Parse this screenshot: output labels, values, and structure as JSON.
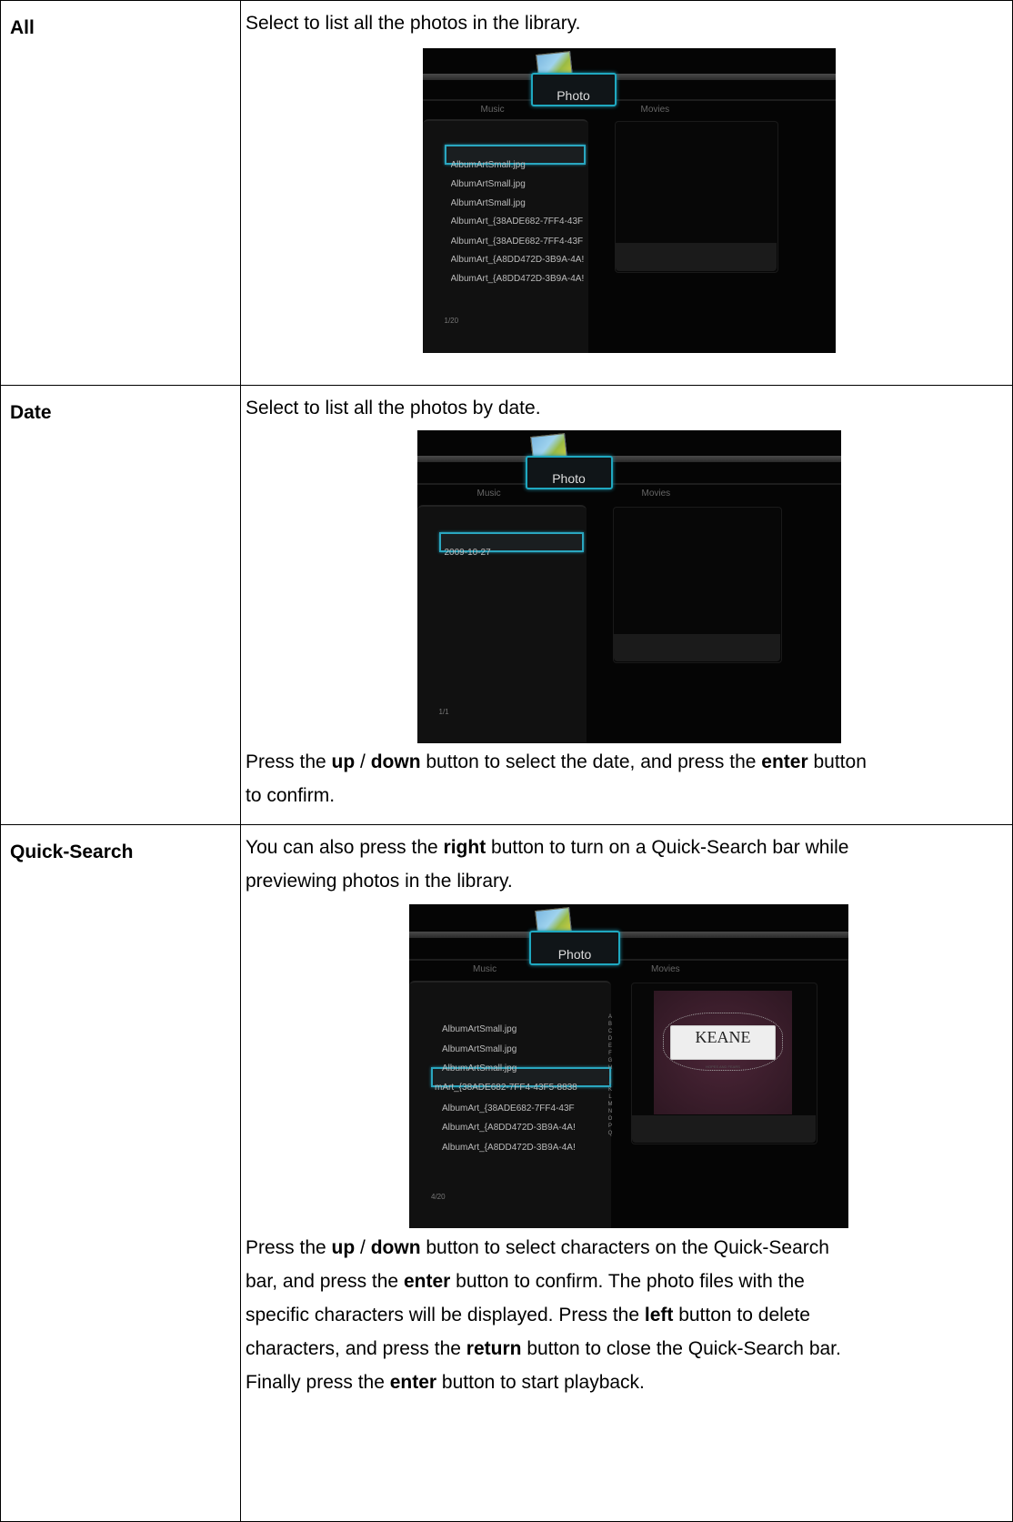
{
  "rows": {
    "all": {
      "label": "All",
      "desc": "Select to list all the photos in the library.",
      "screen": {
        "tab_left": "Music",
        "tab_center": "Photo",
        "tab_right": "Movies",
        "items": [
          "AlbumArtSmall.jpg",
          "AlbumArtSmall.jpg",
          "AlbumArtSmall.jpg",
          "AlbumArt_{38ADE682-7FF4-43F",
          "AlbumArt_{38ADE682-7FF4-43F",
          "AlbumArt_{A8DD472D-3B9A-4A!",
          "AlbumArt_{A8DD472D-3B9A-4A!"
        ],
        "page": "1/20"
      }
    },
    "date": {
      "label": "Date",
      "desc": "Select to list all the photos by date.",
      "screen": {
        "tab_left": "Music",
        "tab_center": "Photo",
        "tab_right": "Movies",
        "items": [
          "2009-10-27"
        ],
        "page": "1/1"
      },
      "note": {
        "p1": "Press the ",
        "b1": "up",
        "p2": " / ",
        "b2": "down",
        "p3": " button to select the date, and press the ",
        "b3": "enter",
        "p4": " button",
        "line2": "to confirm."
      }
    },
    "quick": {
      "label": "Quick-Search",
      "desc": {
        "p1": "You can also press the ",
        "b1": "right",
        "p2": " button to turn on a Quick-Search bar while",
        "line2": "previewing photos in the library."
      },
      "screen": {
        "tab_left": "Music",
        "tab_center": "Photo",
        "tab_right": "Movies",
        "items": [
          "AlbumArtSmall.jpg",
          "AlbumArtSmall.jpg",
          "AlbumArtSmall.jpg",
          "mArt_{38ADE682-7FF4-43F5-8838",
          "AlbumArt_{38ADE682-7FF4-43F",
          "AlbumArt_{A8DD472D-3B9A-4A!",
          "AlbumArt_{A8DD472D-3B9A-4A!"
        ],
        "page": "4/20",
        "alphabet": [
          "A",
          "B",
          "C",
          "D",
          "E",
          "F",
          "G",
          "H",
          "I",
          "J",
          "K",
          "L",
          "M",
          "N",
          "O",
          "P",
          "Q"
        ],
        "art_title": "KEANE",
        "art_sub": "HOPES AND FEARS"
      },
      "note": {
        "l1a": "Press the ",
        "l1b": "up",
        "l1c": " / ",
        "l1d": "down",
        "l1e": " button to select characters on the Quick-Search",
        "l2a": "bar, and press the ",
        "l2b": "enter",
        "l2c": " button to confirm. The photo files with the",
        "l3a": "specific characters will be displayed. Press the ",
        "l3b": "left",
        "l3c": " button to delete",
        "l4a": "characters, and press the ",
        "l4b": "return",
        "l4c": " button to close the Quick-Search bar.",
        "l5a": "Finally press the ",
        "l5b": "enter",
        "l5c": " button to start playback."
      }
    }
  }
}
